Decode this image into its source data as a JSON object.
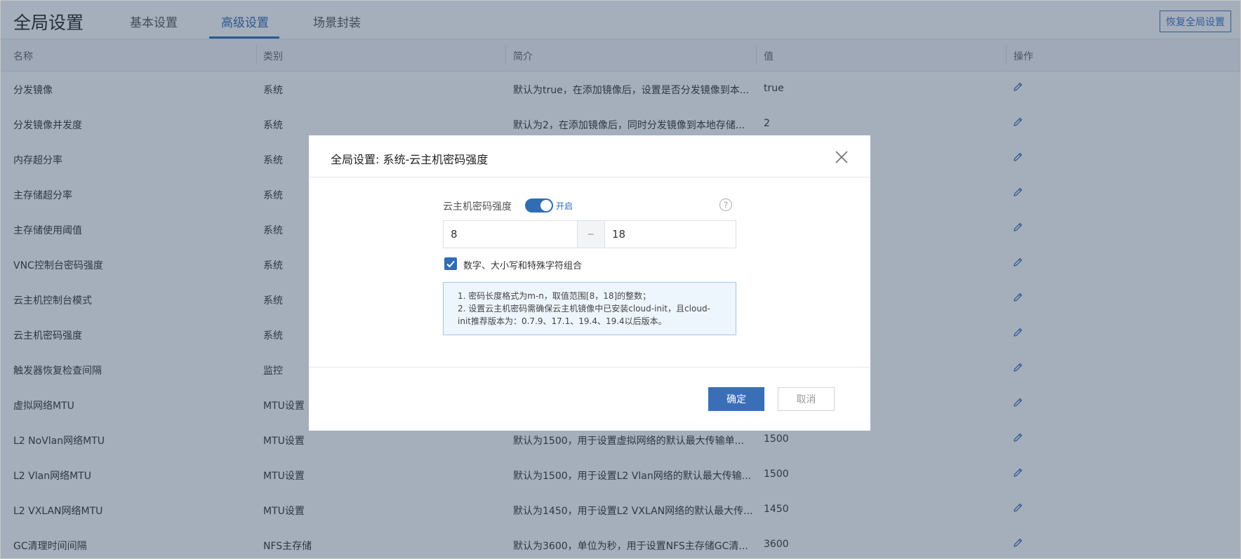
{
  "header": {
    "title": "全局设置",
    "tabs": [
      {
        "label": "基本设置"
      },
      {
        "label": "高级设置",
        "active": true
      },
      {
        "label": "场景封装"
      }
    ],
    "restore_button": "恢复全局设置"
  },
  "table": {
    "columns": [
      "名称",
      "类别",
      "简介",
      "值",
      "操作"
    ],
    "rows": [
      {
        "name": "分发镜像",
        "category": "系统",
        "desc": "默认为true，在添加镜像后，设置是否分发镜像到本...",
        "value": "true"
      },
      {
        "name": "分发镜像并发度",
        "category": "系统",
        "desc": "默认为2，在添加镜像后，同时分发镜像到本地存储...",
        "value": "2"
      },
      {
        "name": "内存超分率",
        "category": "系统",
        "desc": "",
        "value": ""
      },
      {
        "name": "主存储超分率",
        "category": "系统",
        "desc": "",
        "value": ""
      },
      {
        "name": "主存储使用阈值",
        "category": "系统",
        "desc": "",
        "value": ""
      },
      {
        "name": "VNC控制台密码强度",
        "category": "系统",
        "desc": "",
        "value": ""
      },
      {
        "name": "云主机控制台模式",
        "category": "系统",
        "desc": "",
        "value": ""
      },
      {
        "name": "云主机密码强度",
        "category": "系统",
        "desc": "",
        "value": ""
      },
      {
        "name": "触发器恢复检查间隔",
        "category": "监控",
        "desc": "",
        "value": ""
      },
      {
        "name": "虚拟网络MTU",
        "category": "MTU设置",
        "desc": "",
        "value": ""
      },
      {
        "name": "L2 NoVlan网络MTU",
        "category": "MTU设置",
        "desc": "默认为1500，用于设置虚拟网络的默认最大传输单...",
        "value": "1500"
      },
      {
        "name": "L2 Vlan网络MTU",
        "category": "MTU设置",
        "desc": "默认为1500，用于设置L2 Vlan网络的默认最大传输...",
        "value": "1500"
      },
      {
        "name": "L2 VXLAN网络MTU",
        "category": "MTU设置",
        "desc": "默认为1450，用于设置L2 VXLAN网络的默认最大传...",
        "value": "1450"
      },
      {
        "name": "GC清理时间间隔",
        "category": "NFS主存储",
        "desc": "默认为3600，单位为秒，用于设置NFS主存储GC清...",
        "value": "3600"
      }
    ]
  },
  "modal": {
    "title": "全局设置: 系统-云主机密码强度",
    "field_label": "云主机密码强度",
    "toggle_on": true,
    "toggle_label": "开启",
    "range_min": "8",
    "range_separator": "~",
    "range_max": "18",
    "checkbox_checked": true,
    "checkbox_label": "数字、大小写和特殊字符组合",
    "tips": [
      "1. 密码长度格式为m-n，取值范围[8，18]的整数；",
      "2. 设置云主机密码需确保云主机镜像中已安装cloud-init，且cloud-",
      "init推荐版本为：0.7.9、17.1、19.4、19.4以后版本。"
    ],
    "ok_button": "确定",
    "cancel_button": "取消"
  },
  "colors": {
    "accent": "#2f6db5",
    "overlay": "#283e5c",
    "tip_background": "#eef6fd"
  },
  "icons": {
    "edit": "pencil-icon",
    "close": "close-icon",
    "help": "question-circle-icon",
    "check": "checkmark-icon"
  }
}
